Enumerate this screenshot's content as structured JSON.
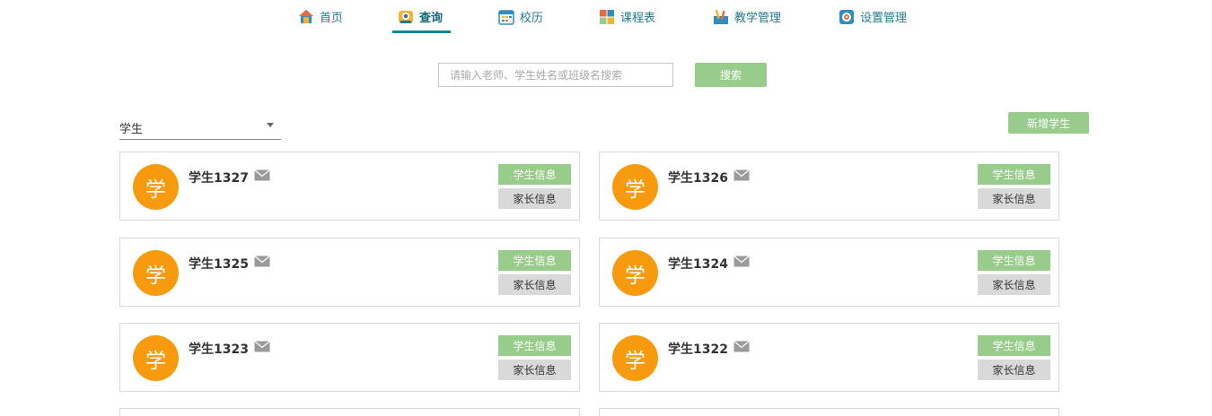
{
  "nav": {
    "items": [
      {
        "label": "首页",
        "icon": "home-icon"
      },
      {
        "label": "查询",
        "icon": "query-icon",
        "active": true
      },
      {
        "label": "校历",
        "icon": "calendar-icon"
      },
      {
        "label": "课程表",
        "icon": "schedule-icon"
      },
      {
        "label": "教学管理",
        "icon": "teaching-icon"
      },
      {
        "label": "设置管理",
        "icon": "settings-icon"
      }
    ]
  },
  "search": {
    "placeholder": "请输入老师、学生姓名或班级名搜索",
    "value": "",
    "button_label": "搜索"
  },
  "filter": {
    "role_selected": "学生"
  },
  "toolbar": {
    "add_label": "新增学生"
  },
  "colors": {
    "accent": "#98cc8b",
    "avatar": "#f79a0d",
    "nav_text": "#1f7a8c"
  },
  "cards": [
    {
      "avatar_char": "学",
      "name": "学生1327",
      "info_label": "学生信息",
      "parent_label": "家长信息"
    },
    {
      "avatar_char": "学",
      "name": "学生1326",
      "info_label": "学生信息",
      "parent_label": "家长信息"
    },
    {
      "avatar_char": "学",
      "name": "学生1325",
      "info_label": "学生信息",
      "parent_label": "家长信息"
    },
    {
      "avatar_char": "学",
      "name": "学生1324",
      "info_label": "学生信息",
      "parent_label": "家长信息"
    },
    {
      "avatar_char": "学",
      "name": "学生1323",
      "info_label": "学生信息",
      "parent_label": "家长信息"
    },
    {
      "avatar_char": "学",
      "name": "学生1322",
      "info_label": "学生信息",
      "parent_label": "家长信息"
    }
  ]
}
